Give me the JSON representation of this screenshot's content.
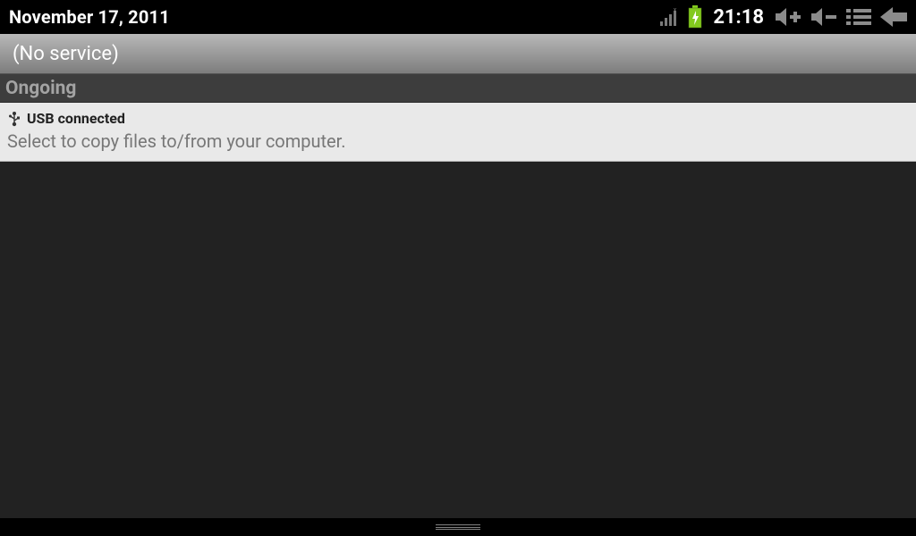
{
  "statusbar": {
    "date": "November 17, 2011",
    "time": "21:18"
  },
  "banner": {
    "service_text": "(No service)"
  },
  "sections": {
    "ongoing_label": "Ongoing"
  },
  "notifications": {
    "usb": {
      "title": "USB connected",
      "subtitle": "Select to copy files to/from your computer."
    }
  },
  "icons": {
    "signal": "signal-icon",
    "battery": "battery-charging-icon",
    "volume_up": "volume-up-icon",
    "volume_down": "volume-down-icon",
    "menu": "menu-icon",
    "back": "back-icon",
    "usb": "usb-icon"
  }
}
